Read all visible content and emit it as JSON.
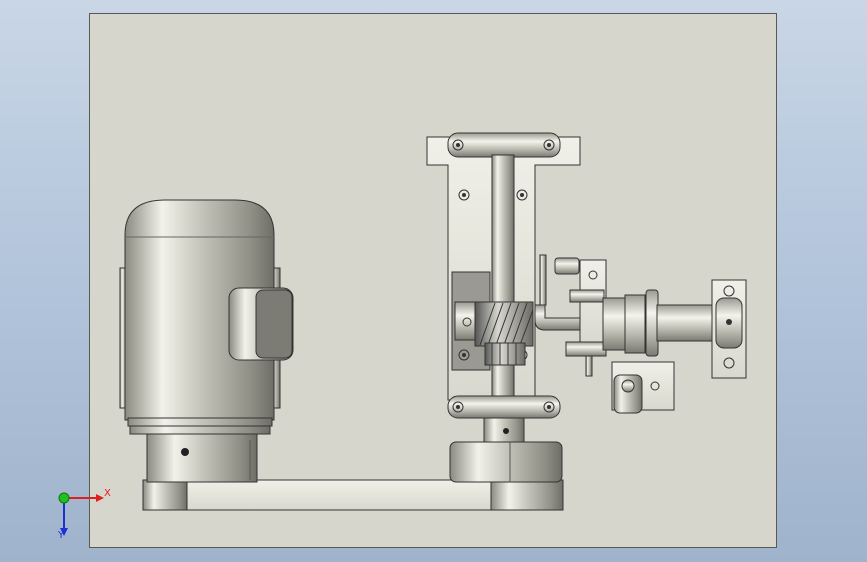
{
  "viewport": {
    "background": "gradient-blue"
  },
  "sheet": {
    "color": "#d6d6cc"
  },
  "triad": {
    "x_label": "X",
    "y_label": "Y",
    "x_color": "#e02020",
    "y_color": "#2030d0",
    "origin_color": "#20c020"
  },
  "model": {
    "parts": [
      "motor",
      "mounting-base",
      "shaft-column",
      "worm-gear",
      "output-shaft",
      "bearing-blocks"
    ]
  }
}
